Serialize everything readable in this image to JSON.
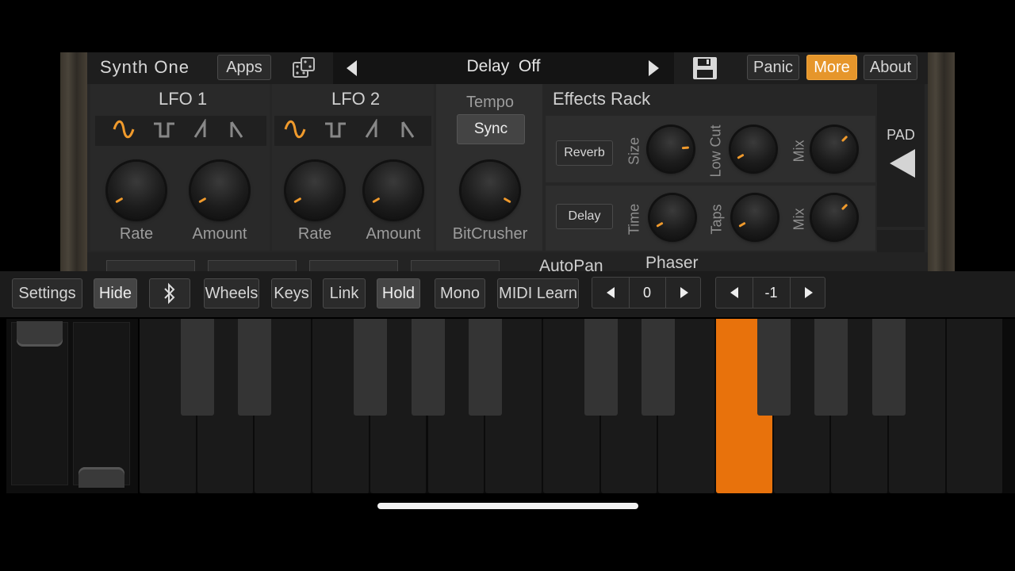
{
  "header": {
    "app_title": "Synth One",
    "apps_label": "Apps",
    "preset_name": "Delay  Off",
    "panic_label": "Panic",
    "more_label": "More",
    "about_label": "About"
  },
  "lfo1": {
    "title": "LFO 1",
    "rate_label": "Rate",
    "amount_label": "Amount",
    "rate_value": 0.05,
    "amount_value": 0.08
  },
  "lfo2": {
    "title": "LFO 2",
    "rate_label": "Rate",
    "amount_label": "Amount",
    "rate_value": 0.05,
    "amount_value": 0.08
  },
  "tempo": {
    "title": "Tempo",
    "sync_label": "Sync",
    "bitcrusher_label": "BitCrusher"
  },
  "effects": {
    "title": "Effects Rack",
    "reverb_label": "Reverb",
    "size_label": "Size",
    "lowcut_label": "Low Cut",
    "mix_label": "Mix",
    "delay_label": "Delay",
    "time_label": "Time",
    "taps_label": "Taps",
    "mix2_label": "Mix"
  },
  "pad_label": "PAD",
  "partial_labels": {
    "autopan": "AutoPan",
    "phaser": "Phaser"
  },
  "toolbar": {
    "settings_label": "Settings",
    "hide_label": "Hide",
    "wheels_label": "Wheels",
    "keys_label": "Keys",
    "link_label": "Link",
    "hold_label": "Hold",
    "mono_label": "Mono",
    "midi_learn_label": "MIDI Learn",
    "octave_value": "0",
    "transpose_value": "-1"
  },
  "colors": {
    "accent": "#f09a2c",
    "active_key": "#e8720c",
    "more_button": "#e6962b"
  },
  "icons": {
    "dice": "dice-icon",
    "save": "save-icon",
    "bluetooth": "bluetooth-icon",
    "prev": "triangle-left-icon",
    "next": "triangle-right-icon"
  }
}
